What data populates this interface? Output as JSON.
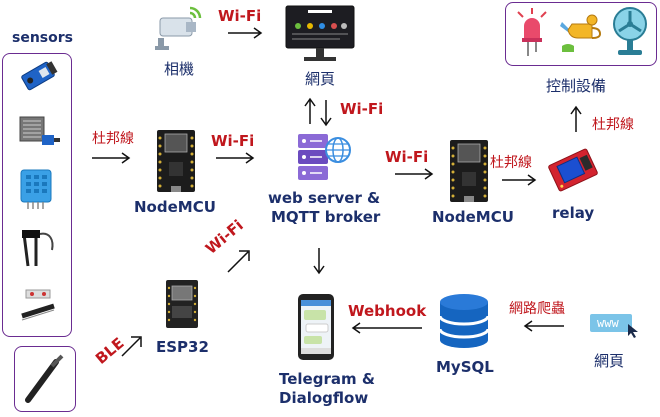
{
  "sensors": {
    "title": "sensors"
  },
  "camera": {
    "label": "相機"
  },
  "webpage_top": {
    "label": "網頁"
  },
  "control": {
    "label": "控制設備"
  },
  "wifi_labels": {
    "camera_to_web": "Wi-Fi",
    "web_broker": "Wi-Fi",
    "mcu1_to_broker": "Wi-Fi",
    "broker_to_mcu2": "Wi-Fi",
    "esp32": "Wi-Fi"
  },
  "dupont_labels": {
    "sensors_to_mcu1": "杜邦線",
    "mcu2_to_relay": "杜邦線",
    "relay_to_control": "杜邦線"
  },
  "nodes": {
    "mcu1": "NodeMCU",
    "broker_line1": "web server &",
    "broker_line2": "MQTT broker",
    "mcu2": "NodeMCU",
    "relay": "relay",
    "esp32": "ESP32",
    "telegram_line1": "Telegram &",
    "telegram_line2": "Dialogflow",
    "mysql": "MySQL",
    "webpage_bottom": "網頁",
    "www": "www"
  },
  "edge_labels": {
    "ble": "BLE",
    "webhook": "Webhook",
    "crawler": "網路爬蟲"
  },
  "colors": {
    "navy": "#1c2f6b",
    "red": "#c0171d",
    "purple_border": "#6a2c91",
    "mysql_blue": "#1565c0"
  }
}
